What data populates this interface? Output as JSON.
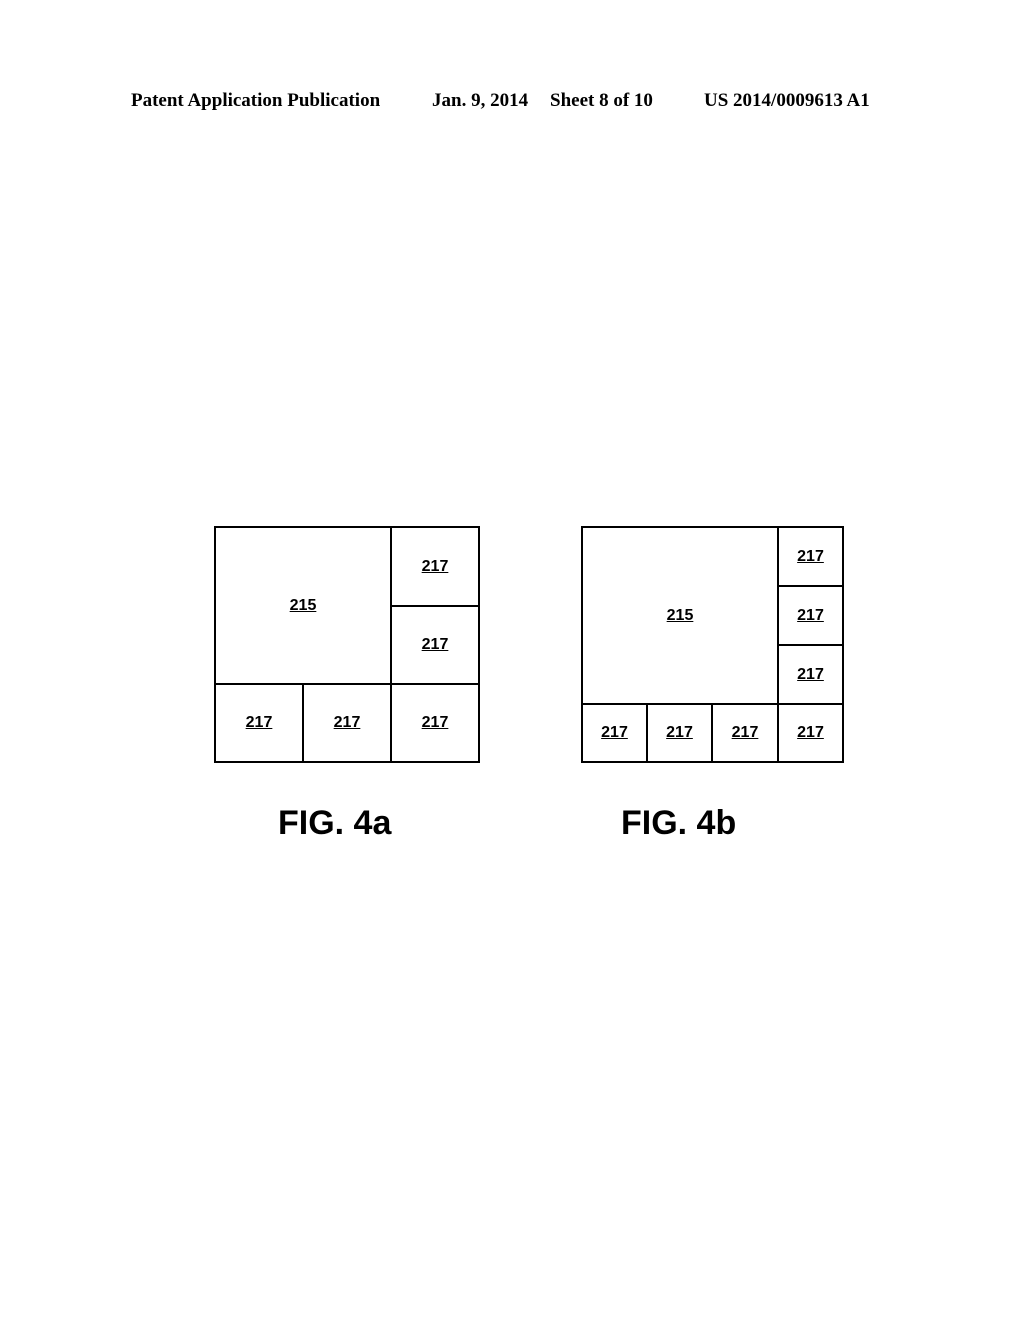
{
  "header": {
    "publication": "Patent Application Publication",
    "date": "Jan. 9, 2014",
    "sheet": "Sheet 8 of 10",
    "number": "US 2014/0009613 A1"
  },
  "figures": [
    {
      "caption": "FIG. 4a",
      "main_label": "215",
      "sub_labels": [
        "217",
        "217",
        "217",
        "217",
        "217"
      ]
    },
    {
      "caption": "FIG. 4b",
      "main_label": "215",
      "sub_labels": [
        "217",
        "217",
        "217",
        "217",
        "217",
        "217",
        "217"
      ]
    }
  ]
}
